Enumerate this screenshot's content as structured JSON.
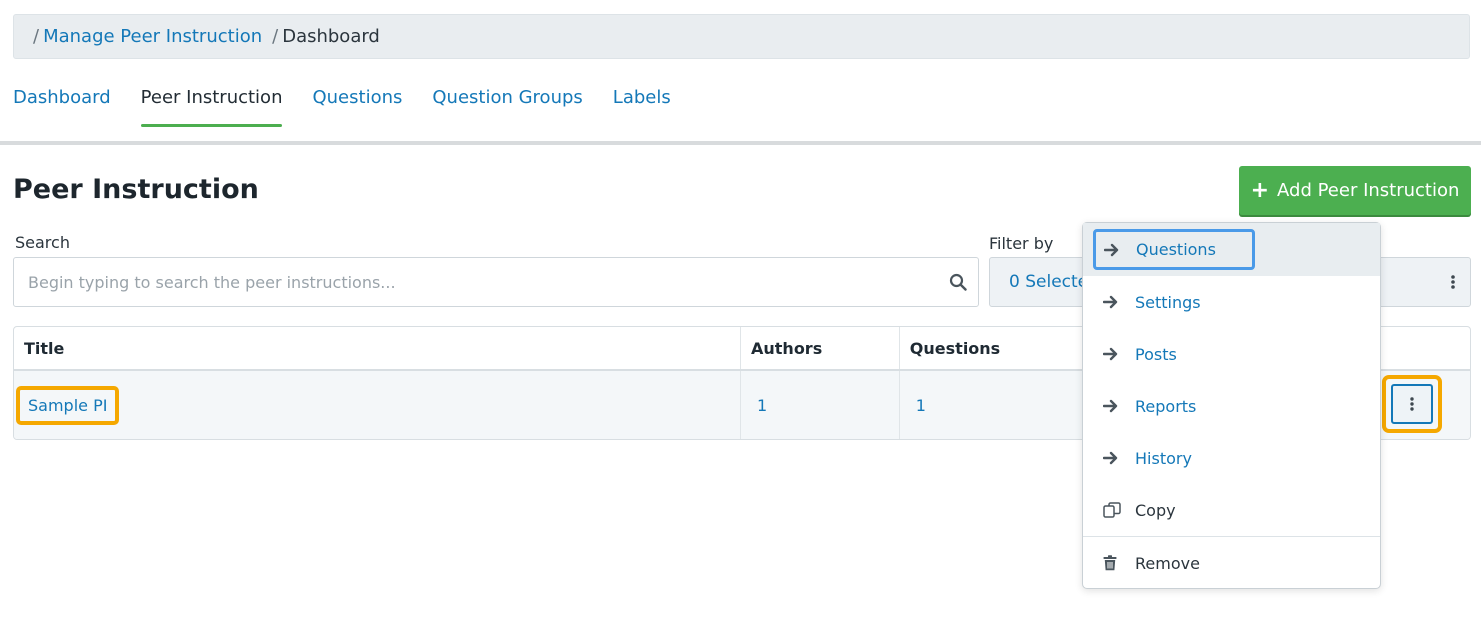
{
  "breadcrumb": {
    "link": "Manage Peer Instruction",
    "current": "Dashboard"
  },
  "tabs": [
    {
      "label": "Dashboard",
      "active": false
    },
    {
      "label": "Peer Instruction",
      "active": true
    },
    {
      "label": "Questions",
      "active": false
    },
    {
      "label": "Question Groups",
      "active": false
    },
    {
      "label": "Labels",
      "active": false
    }
  ],
  "page": {
    "title": "Peer Instruction",
    "add_button_label": "Add Peer Instruction"
  },
  "search": {
    "label": "Search",
    "placeholder": "Begin typing to search the peer instructions..."
  },
  "filter": {
    "label": "Filter by",
    "value": "0 Selected"
  },
  "table": {
    "headers": [
      "Title",
      "Authors",
      "Questions"
    ],
    "rows": [
      {
        "title": "Sample PI",
        "authors": "1",
        "questions": "1"
      }
    ]
  },
  "menu": {
    "items": [
      {
        "label": "Questions",
        "icon": "arrow-right-icon"
      },
      {
        "label": "Settings",
        "icon": "arrow-right-icon"
      },
      {
        "label": "Posts",
        "icon": "arrow-right-icon"
      },
      {
        "label": "Reports",
        "icon": "arrow-right-icon"
      },
      {
        "label": "History",
        "icon": "arrow-right-icon"
      },
      {
        "label": "Copy",
        "icon": "copy-icon"
      },
      {
        "label": "Remove",
        "icon": "trash-icon"
      }
    ]
  },
  "colors": {
    "link": "#1478b8",
    "accent_green": "#4caf50",
    "highlight_orange": "#f5a800",
    "focus_blue": "#4a9ae8"
  }
}
